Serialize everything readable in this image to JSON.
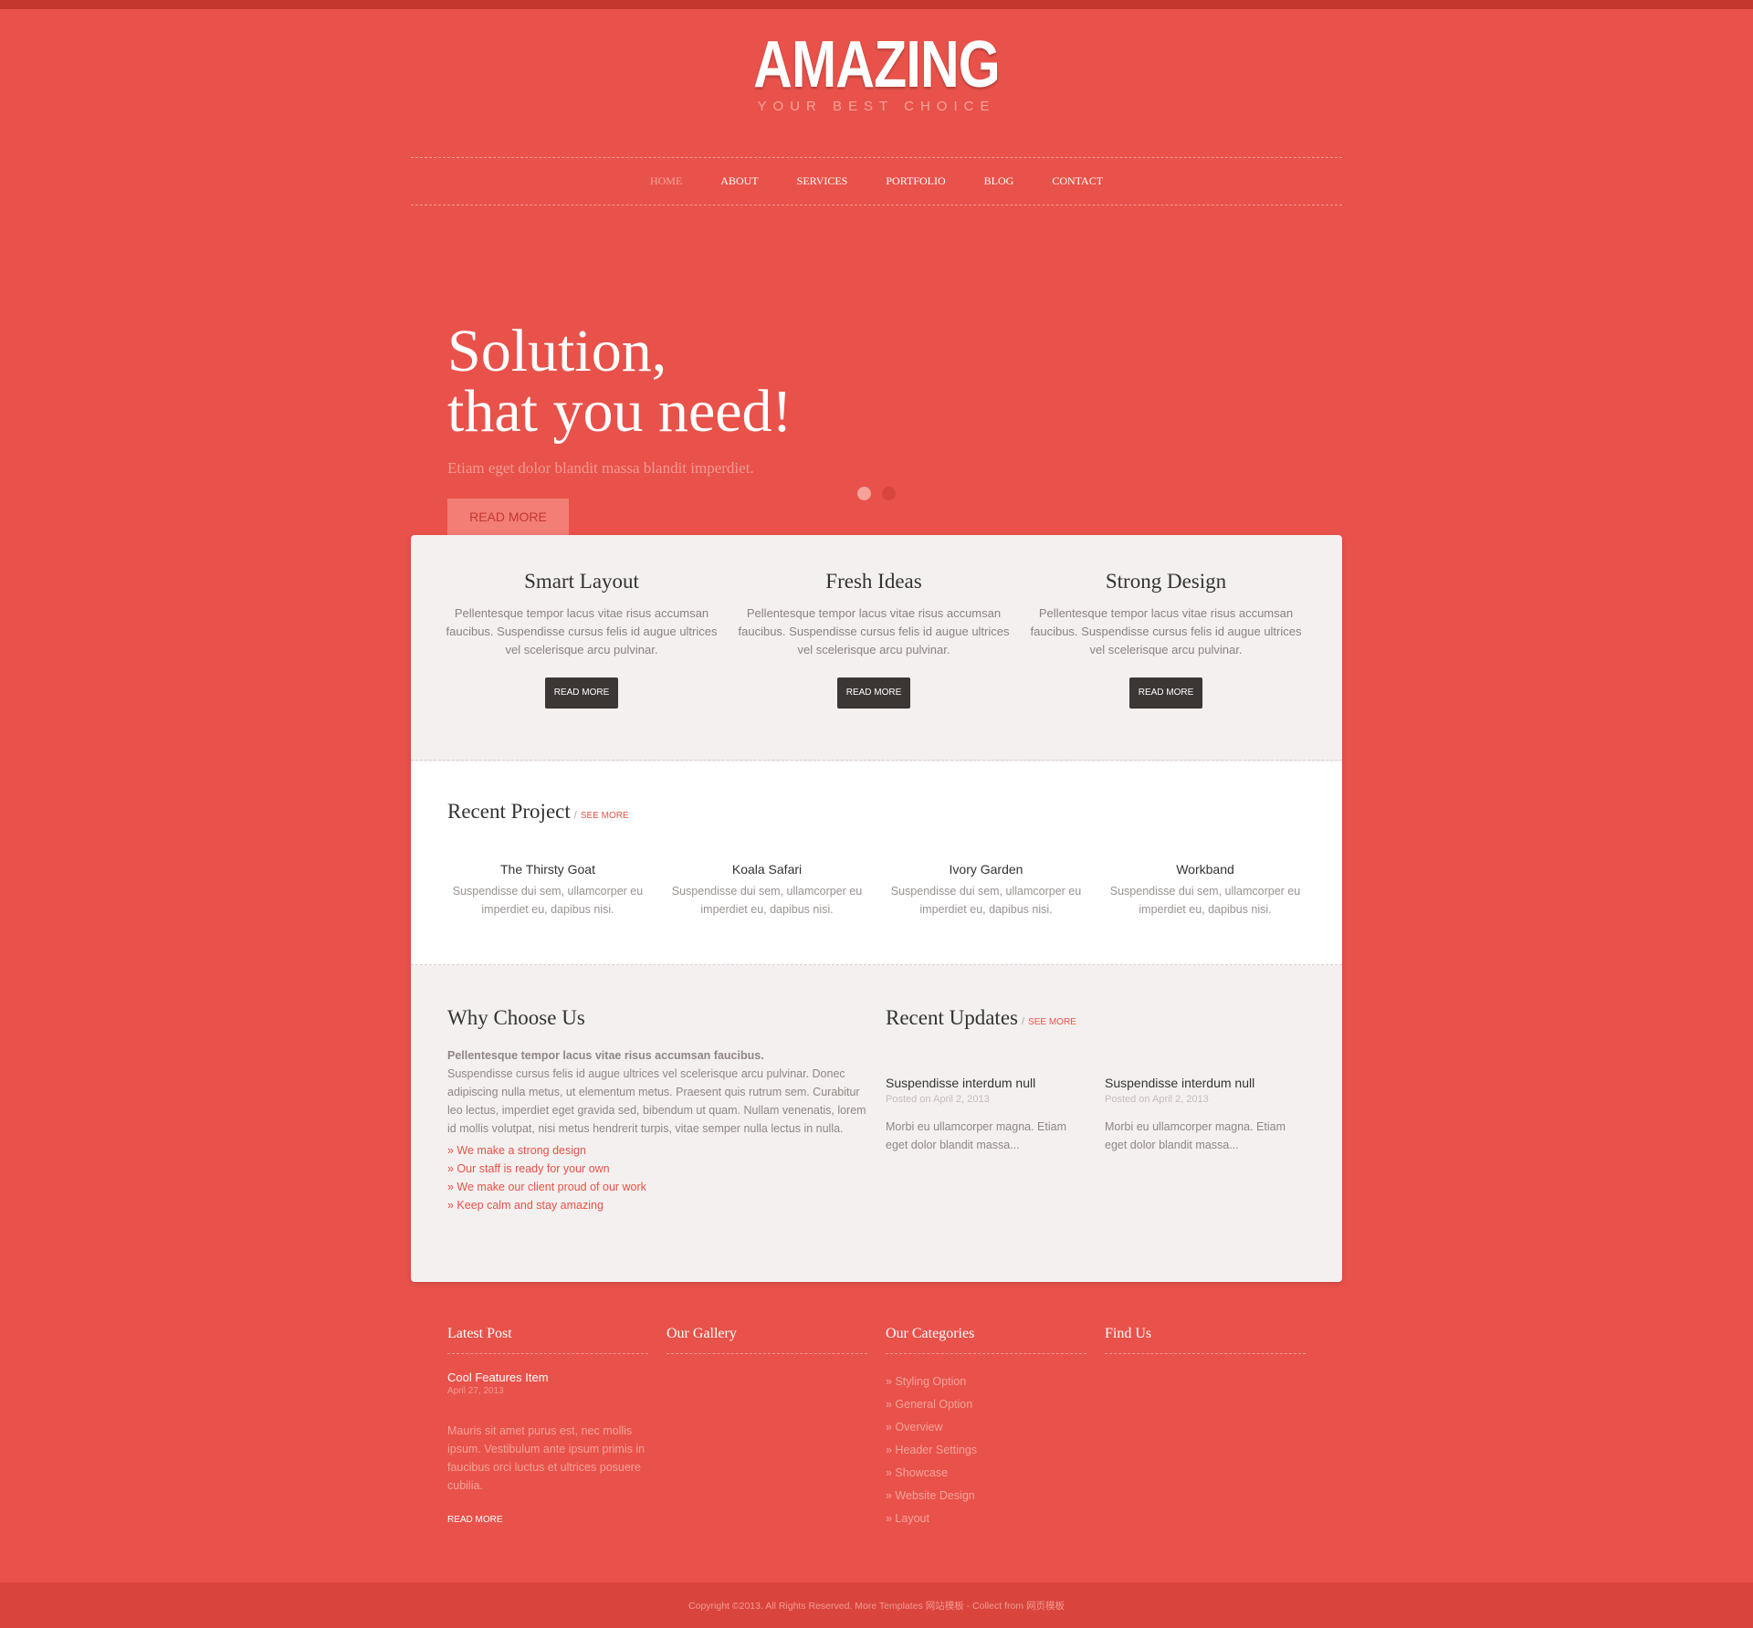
{
  "header": {
    "logo": "AMAZING",
    "tagline": "YOUR BEST CHOICE"
  },
  "nav": {
    "items": [
      "HOME",
      "ABOUT",
      "SERVICES",
      "PORTFOLIO",
      "BLOG",
      "CONTACT"
    ],
    "active": "HOME"
  },
  "hero": {
    "title_line1": "Solution,",
    "title_line2": "that you need!",
    "subtitle": "Etiam eget dolor blandit massa blandit imperdiet.",
    "button": "READ MORE"
  },
  "features": [
    {
      "title": "Smart Layout",
      "text": "Pellentesque tempor lacus vitae risus accumsan faucibus. Suspendisse cursus felis id augue ultrices vel scelerisque arcu pulvinar.",
      "button": "READ MORE"
    },
    {
      "title": "Fresh Ideas",
      "text": "Pellentesque tempor lacus vitae risus accumsan faucibus. Suspendisse cursus felis id augue ultrices vel scelerisque arcu pulvinar.",
      "button": "READ MORE"
    },
    {
      "title": "Strong Design",
      "text": "Pellentesque tempor lacus vitae risus accumsan faucibus. Suspendisse cursus felis id augue ultrices vel scelerisque arcu pulvinar.",
      "button": "READ MORE"
    }
  ],
  "recent_project": {
    "title": "Recent Project",
    "separator": "/",
    "see_more": "SEE MORE",
    "items": [
      {
        "title": "The Thirsty Goat",
        "text": "Suspendisse dui sem, ullamcorper eu imperdiet eu, dapibus nisi."
      },
      {
        "title": "Koala Safari",
        "text": "Suspendisse dui sem, ullamcorper eu imperdiet eu, dapibus nisi."
      },
      {
        "title": "Ivory Garden",
        "text": "Suspendisse dui sem, ullamcorper eu imperdiet eu, dapibus nisi."
      },
      {
        "title": "Workband",
        "text": "Suspendisse dui sem, ullamcorper eu imperdiet eu, dapibus nisi."
      }
    ]
  },
  "why": {
    "title": "Why Choose Us",
    "lead": "Pellentesque tempor lacus vitae risus accumsan faucibus.",
    "body": "Suspendisse cursus felis id augue ultrices vel scelerisque arcu pulvinar. Donec adipiscing nulla metus, ut elementum metus. Praesent quis rutrum sem. Curabitur leo lectus, imperdiet eget gravida sed, bibendum ut quam. Nullam venenatis, lorem id mollis volutpat, nisi metus hendrerit turpis, vitae semper nulla lectus in nulla.",
    "list": [
      "» We make a strong design",
      "» Our staff is ready for your own",
      "» We make our client proud of our work",
      "» Keep calm and stay amazing"
    ]
  },
  "updates": {
    "title": "Recent Updates",
    "separator": "/",
    "see_more": "SEE MORE",
    "items": [
      {
        "title": "Suspendisse interdum null",
        "date": "Posted on April 2, 2013",
        "text": "Morbi eu ullamcorper magna. Etiam eget dolor blandit massa..."
      },
      {
        "title": "Suspendisse interdum null",
        "date": "Posted on April 2, 2013",
        "text": "Morbi eu ullamcorper magna. Etiam eget dolor blandit massa..."
      }
    ]
  },
  "footer_widgets": {
    "latest_post": {
      "title": "Latest Post",
      "post_title": "Cool Features Item",
      "post_date": "April 27, 2013",
      "post_text": "Mauris sit amet purus est, nec mollis ipsum. Vestibulum ante ipsum primis in faucibus orci luctus et ultrices posuere cubilia.",
      "button": "READ MORE"
    },
    "gallery": {
      "title": "Our Gallery"
    },
    "categories": {
      "title": "Our Categories",
      "items": [
        "» Styling Option",
        "» General Option",
        "» Overview",
        "» Header Settings",
        "» Showcase",
        "» Website Design",
        "» Layout"
      ]
    },
    "find_us": {
      "title": "Find Us"
    }
  },
  "footer": {
    "copyright": "Copyright ©2013. All Rights Reserved. More Templates 网站模板 - Collect from 网页模板"
  },
  "colors": {
    "background": "#e8524a",
    "panel": "#f4f0ef",
    "accent": "#e8524a",
    "dark_button": "#3c3634"
  }
}
